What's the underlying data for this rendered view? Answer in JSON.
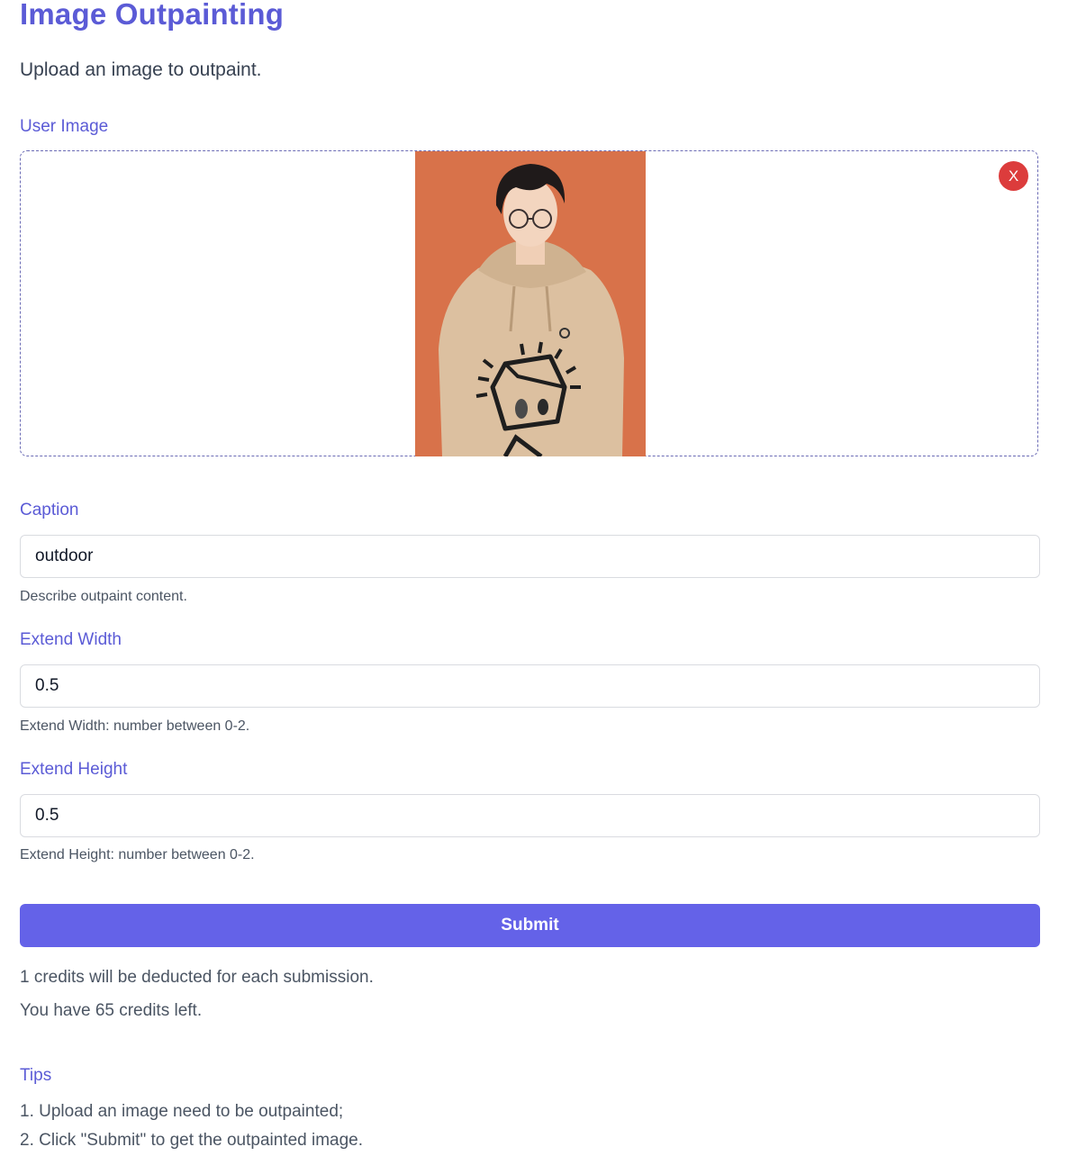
{
  "header": {
    "title": "Image Outpainting",
    "subtitle": "Upload an image to outpaint."
  },
  "upload": {
    "label": "User Image",
    "remove_label": "X",
    "photo_bg": "#d8724a"
  },
  "caption": {
    "label": "Caption",
    "value": "outdoor",
    "hint": "Describe outpaint content."
  },
  "extend_width": {
    "label": "Extend Width",
    "value": "0.5",
    "hint": "Extend Width: number between 0-2."
  },
  "extend_height": {
    "label": "Extend Height",
    "value": "0.5",
    "hint": "Extend Height: number between 0-2."
  },
  "submit": {
    "label": "Submit"
  },
  "credits": {
    "cost_text": "1 credits will be deducted for each submission.",
    "remaining_text": "You have 65 credits left."
  },
  "tips": {
    "title": "Tips",
    "items": [
      "1. Upload an image need to be outpainted;",
      "2. Click \"Submit\" to get the outpainted image."
    ]
  },
  "colors": {
    "accent": "#5b5bd6",
    "button": "#6462e8",
    "remove": "#dc3c3c"
  }
}
